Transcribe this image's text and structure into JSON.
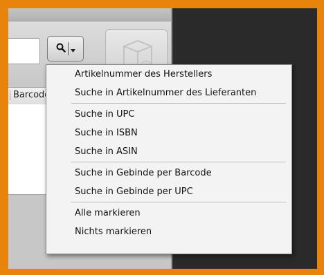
{
  "search": {
    "input_value": "",
    "button_icon": "magnifier-icon",
    "dropdown_icon": "chevron-down-icon"
  },
  "table": {
    "columns": [
      "Barcode"
    ]
  },
  "placeholder_icon": "product-box-icon",
  "dropdown_menu": {
    "groups": [
      [
        "Artikelnummer des Herstellers",
        "Suche in Artikelnummer des Lieferanten"
      ],
      [
        "Suche in UPC",
        "Suche in ISBN",
        "Suche in ASIN"
      ],
      [
        "Suche in Gebinde per Barcode",
        "Suche in Gebinde per UPC"
      ],
      [
        "Alle markieren",
        "Nichts markieren"
      ]
    ]
  },
  "colors": {
    "window_border": "#e8830c",
    "background": "#2a2a2a",
    "menu_bg": "#f3f3f3"
  }
}
